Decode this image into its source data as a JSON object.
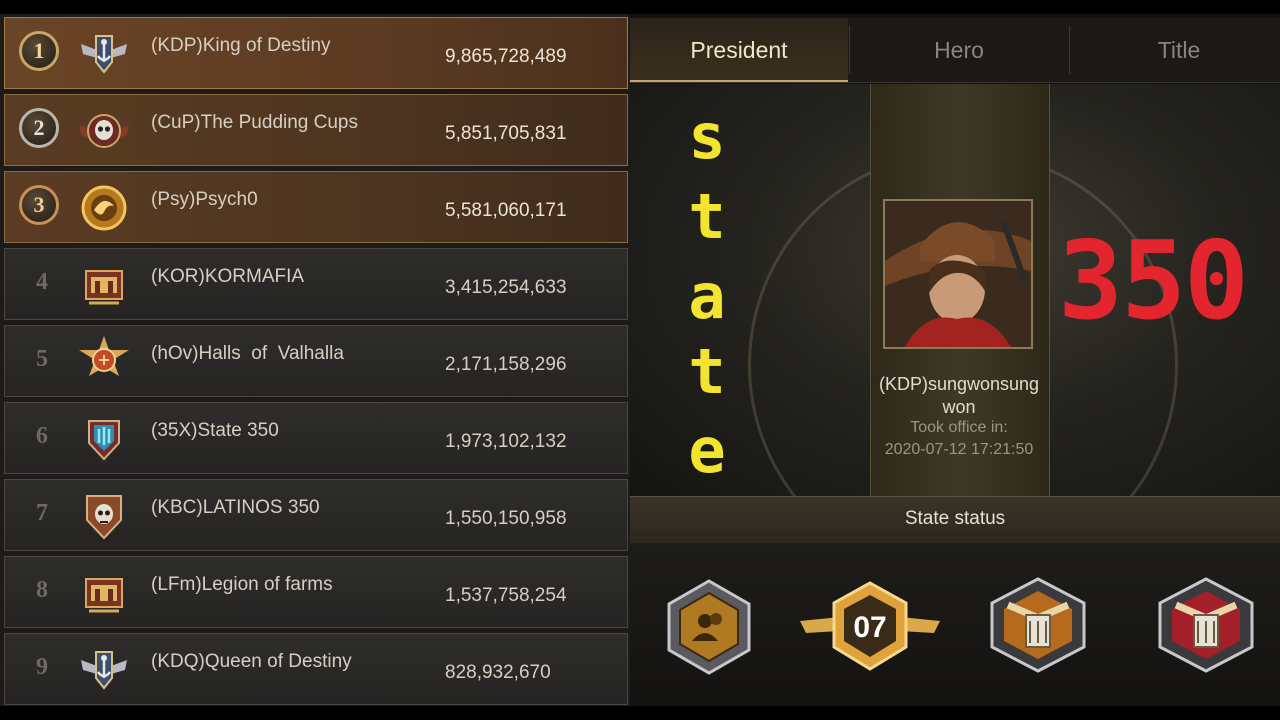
{
  "tabs": [
    {
      "label": "President",
      "active": true
    },
    {
      "label": "Hero",
      "active": false
    },
    {
      "label": "Title",
      "active": false
    }
  ],
  "rankings": [
    {
      "rank": "1",
      "name": "(KDP)King of Destiny",
      "score": "9,865,728,489",
      "emblem": "winged-anchor-emblem"
    },
    {
      "rank": "2",
      "name": "(CuP)The Pudding Cups",
      "score": "5,851,705,831",
      "emblem": "skull-wings-emblem"
    },
    {
      "rank": "3",
      "name": "(Psy)Psych0",
      "score": "5,581,060,171",
      "emblem": "gold-dragon-emblem"
    },
    {
      "rank": "4",
      "name": "(KOR)KORMAFIA",
      "score": "3,415,254,633",
      "emblem": "fortress-emblem"
    },
    {
      "rank": "5",
      "name": "(hOv)Halls  of  Valhalla",
      "score": "2,171,158,296",
      "emblem": "star-shield-emblem"
    },
    {
      "rank": "6",
      "name": "(35X)State 350",
      "score": "1,973,102,132",
      "emblem": "blue-shield-emblem"
    },
    {
      "rank": "7",
      "name": "(KBC)LATINOS 350",
      "score": "1,550,150,958",
      "emblem": "skull-shield-emblem"
    },
    {
      "rank": "8",
      "name": "(LFm)Legion of farms",
      "score": "1,537,758,254",
      "emblem": "fortress-emblem"
    },
    {
      "rank": "9",
      "name": "(KDQ)Queen of Destiny",
      "score": "828,932,670",
      "emblem": "winged-anchor-emblem"
    }
  ],
  "president": {
    "name_line1": "(KDP)sungwonsung",
    "name_line2": "won",
    "took_office_label": "Took office in:",
    "took_office_time": "2020-07-12  17:21:50"
  },
  "state_status_label": "State status",
  "status_badges": [
    {
      "icon": "president-hexagon-icon"
    },
    {
      "icon": "level-badge-icon",
      "text": "07"
    },
    {
      "icon": "crossed-pistols-icon"
    },
    {
      "icon": "crossed-pistols-red-icon"
    }
  ],
  "overlay": {
    "word_letters": [
      "s",
      "t",
      "a",
      "t",
      "e"
    ],
    "number": "350"
  },
  "colors": {
    "overlay_word": "#f3e52f",
    "overlay_number": "#e2252f",
    "gold": "#c9a667"
  }
}
